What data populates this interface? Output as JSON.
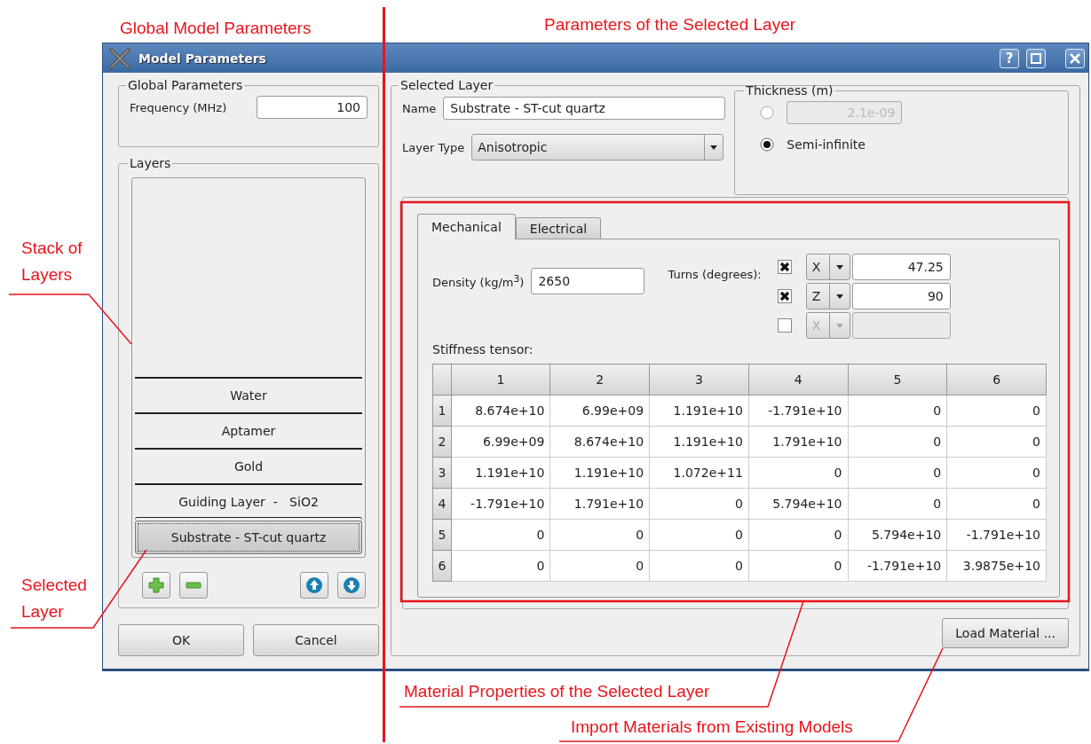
{
  "annotations": [
    {
      "text": "Global Model Parameters"
    },
    {
      "text": "Parameters of the Selected Layer"
    },
    {
      "text": "Stack of Layers"
    },
    {
      "text": "Selected Layer"
    },
    {
      "text": "Material Properties of the Selected Layer"
    },
    {
      "text": "Import Materials from Existing Models"
    }
  ],
  "window": {
    "title": "Model Parameters",
    "help": "?"
  },
  "global_parameters": {
    "title": "Global Parameters",
    "frequency": {
      "label": "Frequency (MHz)",
      "value": "100"
    }
  },
  "layers": {
    "title": "Layers",
    "items": [
      {
        "name": "Water",
        "selected": false
      },
      {
        "name": "Aptamer",
        "selected": false
      },
      {
        "name": "Gold",
        "selected": false
      },
      {
        "name": "Guiding Layer  -   SiO2",
        "selected": false
      },
      {
        "name": "Substrate - ST-cut quartz",
        "selected": true
      }
    ]
  },
  "dialog_buttons": [
    "OK",
    "Cancel"
  ],
  "selected_layer": {
    "title": "Selected Layer",
    "name": {
      "label": "Name",
      "value": "Substrate - ST-cut quartz"
    },
    "layer_type": {
      "label": "Layer Type",
      "value": "Anisotropic"
    },
    "thickness": {
      "title": "Thickness (m)",
      "options": [
        {
          "kind": "value",
          "value": "2.1e-09",
          "selected": false
        },
        {
          "kind": "label",
          "label": "Semi-infinite",
          "selected": true
        }
      ]
    },
    "tabs": [
      {
        "label": "Mechanical",
        "selected": true
      },
      {
        "label": "Electrical",
        "selected": false
      }
    ],
    "density": {
      "label": "Density (kg/m$^{3}$)",
      "value": "2650"
    },
    "turns": {
      "label": "Turns (degrees):",
      "rows": [
        {
          "checked": true,
          "axis": "X",
          "value": "47.25"
        },
        {
          "checked": true,
          "axis": "Z",
          "value": "90"
        },
        {
          "checked": false,
          "axis": "X"
        }
      ]
    },
    "stiffness": {
      "label": "Stiffness tensor:",
      "columns": [
        "1",
        "2",
        "3",
        "4",
        "5",
        "6"
      ],
      "rows": [
        {
          "header": "1",
          "cells": [
            "8.674e+10",
            "6.99e+09",
            "1.191e+10",
            "-1.791e+10",
            "0",
            "0"
          ]
        },
        {
          "header": "2",
          "cells": [
            "6.99e+09",
            "8.674e+10",
            "1.191e+10",
            "1.791e+10",
            "0",
            "0"
          ]
        },
        {
          "header": "3",
          "cells": [
            "1.191e+10",
            "1.191e+10",
            "1.072e+11",
            "0",
            "0",
            "0"
          ]
        },
        {
          "header": "4",
          "cells": [
            "-1.791e+10",
            "1.791e+10",
            "0",
            "5.794e+10",
            "0",
            "0"
          ]
        },
        {
          "header": "5",
          "cells": [
            "0",
            "0",
            "0",
            "0",
            "5.794e+10",
            "-1.791e+10"
          ]
        },
        {
          "header": "6",
          "cells": [
            "0",
            "0",
            "0",
            "0",
            "-1.791e+10",
            "3.9875e+10"
          ]
        }
      ]
    },
    "load_button": "Load Material ..."
  }
}
